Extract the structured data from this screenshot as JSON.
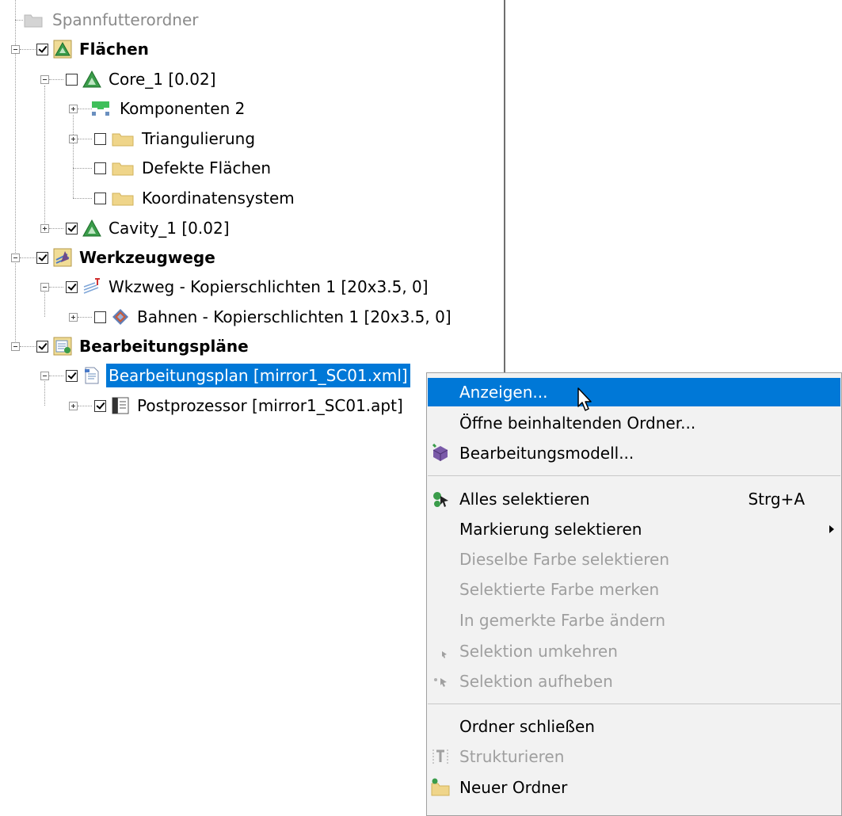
{
  "tree": {
    "items": [
      {
        "label": "Spannfutterordner"
      },
      {
        "label": "Flächen"
      },
      {
        "label": "Core_1 [0.02]"
      },
      {
        "label": "Komponenten 2"
      },
      {
        "label": "Triangulierung"
      },
      {
        "label": "Defekte Flächen"
      },
      {
        "label": "Koordinatensystem"
      },
      {
        "label": "Cavity_1 [0.02]"
      },
      {
        "label": "Werkzeugwege"
      },
      {
        "label": "Wkzweg - Kopierschlichten 1 [20x3.5, 0]"
      },
      {
        "label": "Bahnen - Kopierschlichten 1 [20x3.5, 0]"
      },
      {
        "label": "Bearbeitungspläne"
      },
      {
        "label": "Bearbeitungsplan [mirror1_SC01.xml]"
      },
      {
        "label": "Postprozessor [mirror1_SC01.apt]"
      }
    ]
  },
  "context_menu": {
    "items": [
      {
        "label": "Anzeigen...",
        "state": "highlighted"
      },
      {
        "label": "Öffne beinhaltenden Ordner...",
        "state": "enabled"
      },
      {
        "label": "Bearbeitungsmodell...",
        "state": "enabled",
        "icon": "machining-model-icon"
      },
      {
        "label": "Alles selektieren",
        "shortcut": "Strg+A",
        "state": "enabled",
        "icon": "select-all-icon"
      },
      {
        "label": "Markierung selektieren",
        "state": "enabled",
        "submenu": true
      },
      {
        "label": "Dieselbe Farbe selektieren",
        "state": "disabled"
      },
      {
        "label": "Selektierte Farbe merken",
        "state": "disabled"
      },
      {
        "label": "In gemerkte Farbe ändern",
        "state": "disabled"
      },
      {
        "label": "Selektion umkehren",
        "state": "disabled",
        "icon": "invert-selection-icon"
      },
      {
        "label": "Selektion aufheben",
        "state": "disabled",
        "icon": "deselect-icon"
      },
      {
        "label": "Ordner schließen",
        "state": "enabled"
      },
      {
        "label": "Strukturieren",
        "state": "disabled",
        "icon": "structure-icon"
      },
      {
        "label": "Neuer Ordner",
        "state": "enabled",
        "icon": "new-folder-icon"
      }
    ]
  },
  "colors": {
    "selection": "#0078d7",
    "menu_background": "#f2f2f2",
    "disabled_text": "#9f9f9f",
    "folder": "#efd58a"
  }
}
